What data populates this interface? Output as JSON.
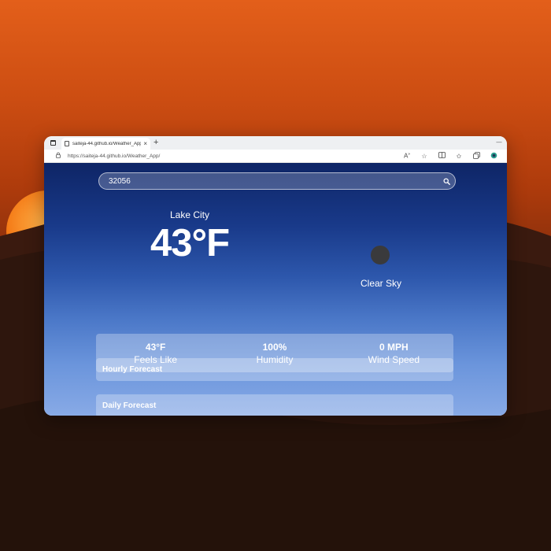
{
  "browser": {
    "tab_title": "saiteja-44.github.io/Weather_App",
    "tab_close": "×",
    "new_tab": "+",
    "minimize": "—",
    "url": "https://saiteja-44.github.io/Weather_App/"
  },
  "app": {
    "search": {
      "value": "32056"
    },
    "location": "Lake City",
    "temperature": "43°F",
    "condition": "Clear Sky",
    "stats": [
      {
        "value": "43°F",
        "label": "Feels Like"
      },
      {
        "value": "100%",
        "label": "Humidity"
      },
      {
        "value": "0 MPH",
        "label": "Wind Speed"
      }
    ],
    "hourly_label": "Hourly Forecast",
    "daily_label": "Daily Forecast"
  },
  "icons": {
    "weather_icon": "dark-circle-icon",
    "search_icon": "magnifier-icon"
  },
  "colors": {
    "gradient_top": "#0e2566",
    "gradient_bottom": "#88aae6",
    "desert_sky": "#e35f1a",
    "sun": "#f47a16"
  }
}
